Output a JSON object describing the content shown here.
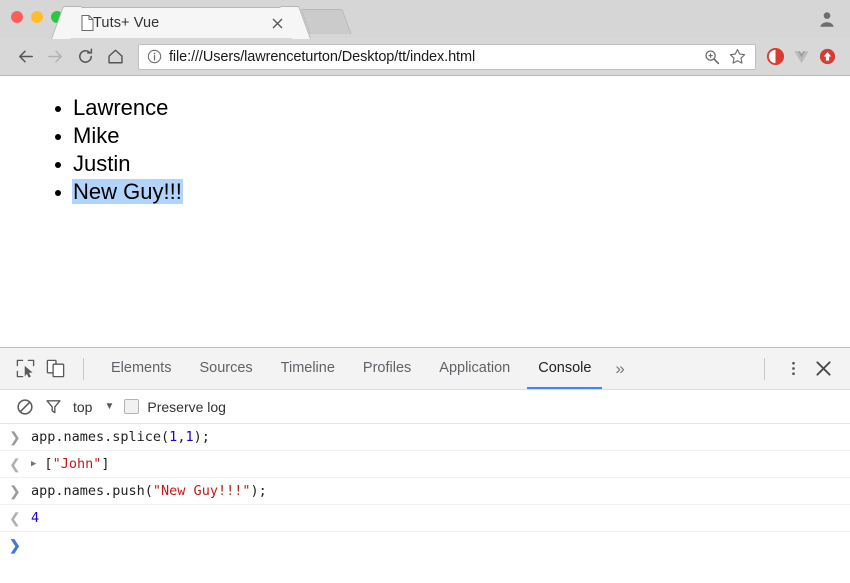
{
  "browser": {
    "window_controls": [
      "close",
      "minimize",
      "maximize"
    ],
    "tab": {
      "title": "Tuts+ Vue",
      "favicon": "page-icon",
      "close_label": "×"
    },
    "new_tab_label": "+",
    "profile_icon": "account-icon",
    "nav": {
      "back": "←",
      "forward": "→",
      "reload": "↻",
      "home": "⌂"
    },
    "omnibox": {
      "info_icon": "info-icon",
      "url": "file:///Users/lawrenceturton/Desktop/tt/index.html",
      "zoom_icon": "zoom-in-icon",
      "bookmark_icon": "star-icon"
    },
    "extensions": [
      {
        "name": "adblock-extension",
        "color": "#d93b30"
      },
      {
        "name": "vue-devtools-extension",
        "color": "#a8a8a8"
      },
      {
        "name": "pocket-extension",
        "color": "#d93b30"
      }
    ]
  },
  "page": {
    "list_items": [
      {
        "text": "Lawrence",
        "selected": false
      },
      {
        "text": "Mike",
        "selected": false
      },
      {
        "text": "Justin",
        "selected": false
      },
      {
        "text": "New Guy!!!",
        "selected": true
      }
    ],
    "selection_color": "#b0d4fb"
  },
  "devtools": {
    "inspect_icon": "inspect-cursor-icon",
    "device_icon": "device-toolbar-icon",
    "tabs": [
      {
        "label": "Elements",
        "active": false
      },
      {
        "label": "Sources",
        "active": false
      },
      {
        "label": "Timeline",
        "active": false
      },
      {
        "label": "Profiles",
        "active": false
      },
      {
        "label": "Application",
        "active": false
      },
      {
        "label": "Console",
        "active": true
      }
    ],
    "overflow_label": "»",
    "menu_icon": "kebab-menu-icon",
    "close_icon": "close-icon",
    "active_tab_accent": "#4285f4",
    "filter_bar": {
      "clear_icon": "clear-console-icon",
      "filter_icon": "filter-funnel-icon",
      "context": "top",
      "context_caret": "▼",
      "preserve_log_label": "Preserve log",
      "preserve_log_checked": false
    },
    "console_rows": [
      {
        "type": "input",
        "gutter": "❯",
        "tokens": [
          {
            "t": "app.names.splice(",
            "c": "plain"
          },
          {
            "t": "1",
            "c": "num"
          },
          {
            "t": ",",
            "c": "plain"
          },
          {
            "t": "1",
            "c": "num"
          },
          {
            "t": ");",
            "c": "plain"
          }
        ]
      },
      {
        "type": "output",
        "gutter": "❮",
        "expand": "▶",
        "tokens": [
          {
            "t": "[",
            "c": "plain"
          },
          {
            "t": "\"John\"",
            "c": "str"
          },
          {
            "t": "]",
            "c": "plain"
          }
        ]
      },
      {
        "type": "input",
        "gutter": "❯",
        "tokens": [
          {
            "t": "app.names.push(",
            "c": "plain"
          },
          {
            "t": "\"New Guy!!!\"",
            "c": "str"
          },
          {
            "t": ");",
            "c": "plain"
          }
        ]
      },
      {
        "type": "output",
        "gutter": "❮",
        "tokens": [
          {
            "t": "4",
            "c": "num"
          }
        ]
      },
      {
        "type": "prompt",
        "gutter": "❯",
        "tokens": []
      }
    ]
  }
}
